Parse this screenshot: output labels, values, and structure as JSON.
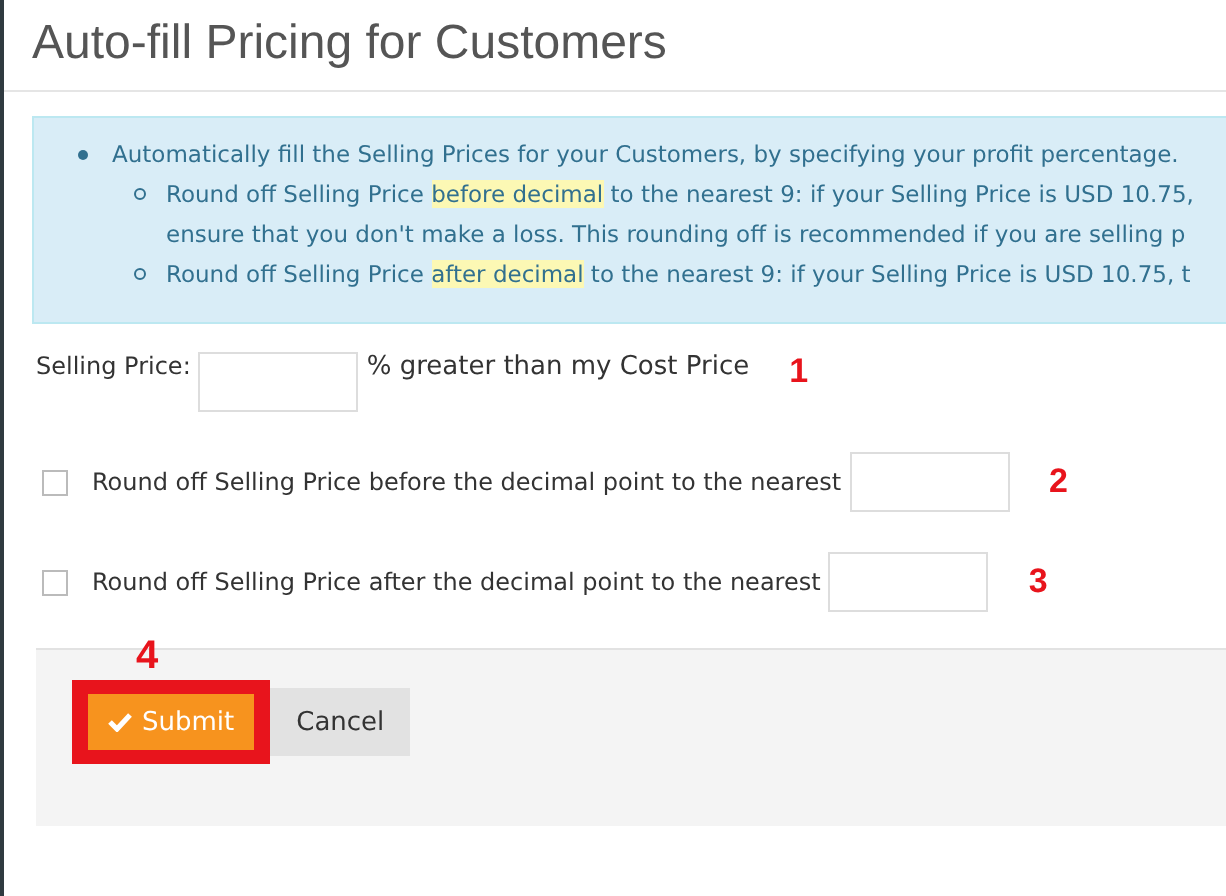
{
  "title": "Auto-fill Pricing for Customers",
  "info": {
    "text": "Automatically fill the Selling Prices for your Customers, by specifying your profit percentage.",
    "sub_items": [
      {
        "lines": [
          "Round off Selling Price **before decimal** to the nearest 9: if your Selling Price is USD 10.75,",
          "ensure that you don't make a loss. This rounding off is recommended if you are selling p"
        ]
      },
      {
        "lines": [
          "Round off Selling Price **after decimal** to the nearest 9: if your Selling Price is USD 10.75, t"
        ]
      }
    ]
  },
  "fields": [
    {
      "kind": "percent",
      "label": "Selling Price:",
      "suffix": "% greater than my Cost Price",
      "annotation": "1"
    },
    {
      "kind": "checkbox",
      "label": "Round off Selling Price before the decimal point to the nearest",
      "checked": false,
      "annotation": "2"
    },
    {
      "kind": "checkbox",
      "label": "Round off Selling Price after the decimal point to the nearest",
      "checked": false,
      "annotation": "3"
    }
  ],
  "footer": {
    "annotation": "4",
    "submit": "Submit",
    "cancel": "Cancel"
  }
}
